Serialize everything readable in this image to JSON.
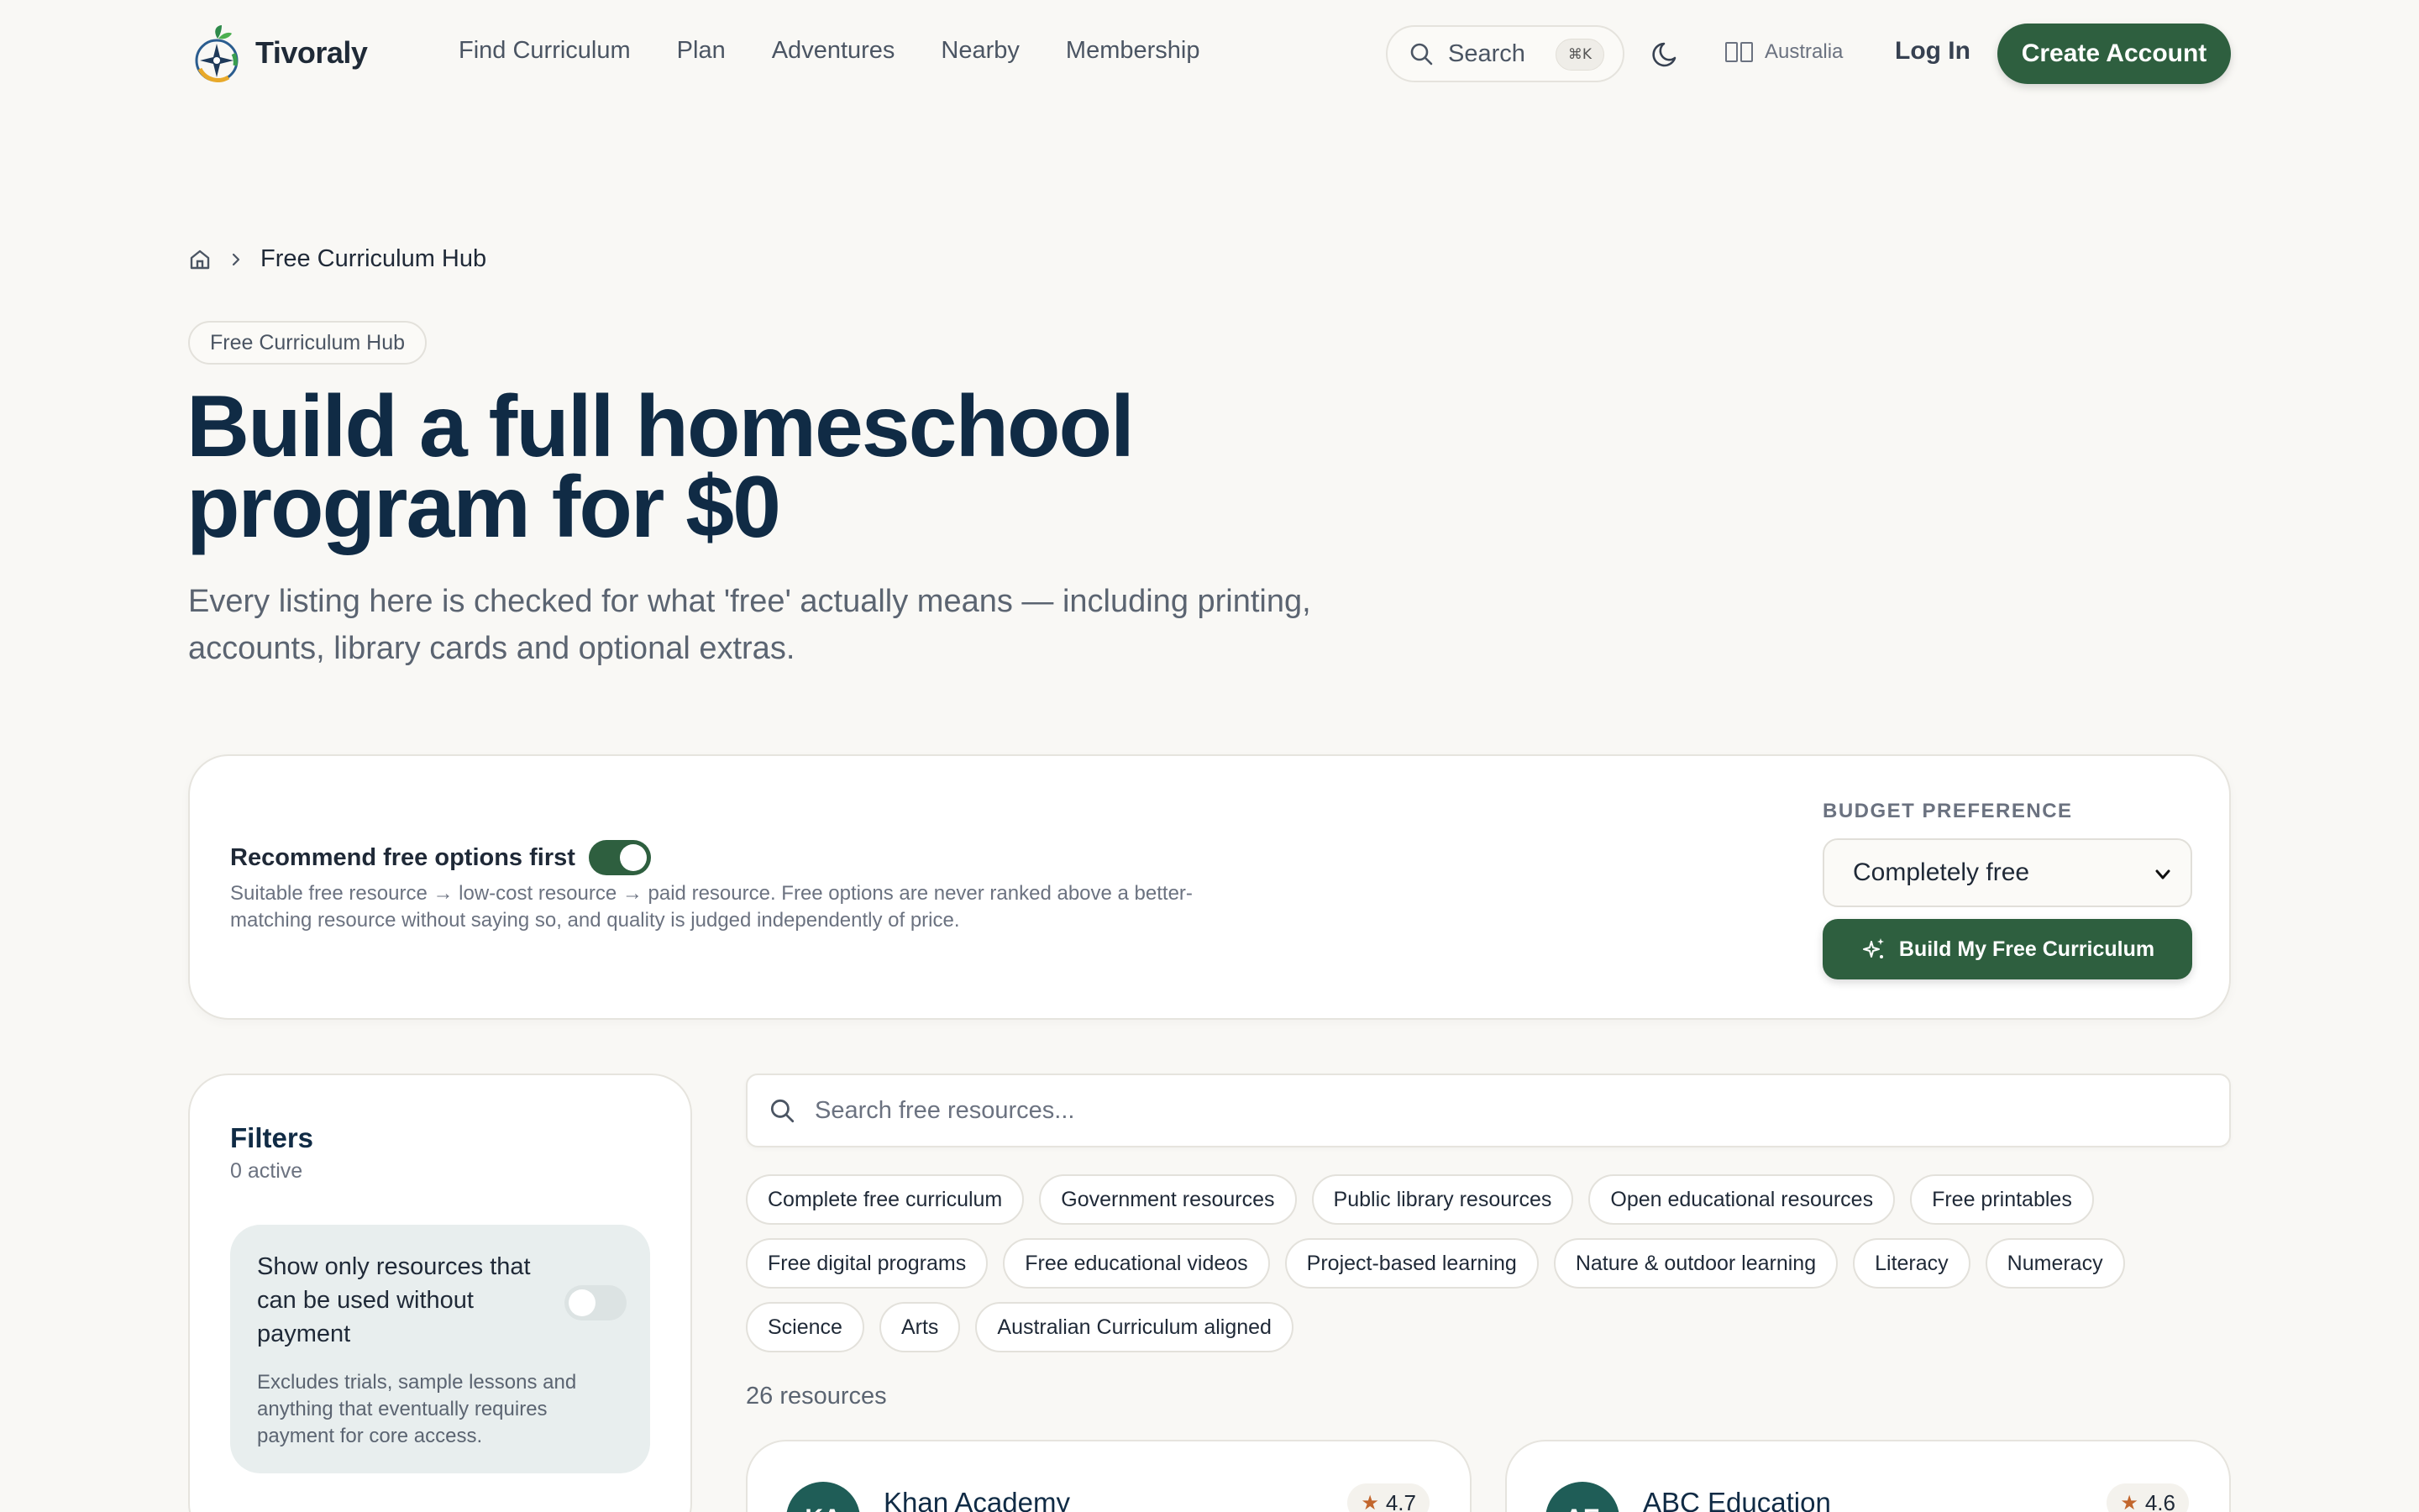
{
  "header": {
    "brand": "Tivoraly",
    "nav": [
      "Find Curriculum",
      "Plan",
      "Adventures",
      "Nearby",
      "Membership"
    ],
    "search_label": "Search",
    "search_shortcut": "⌘K",
    "region": "Australia",
    "login": "Log In",
    "create_account": "Create Account"
  },
  "breadcrumb": {
    "current": "Free Curriculum Hub"
  },
  "hero": {
    "tag": "Free Curriculum Hub",
    "title": "Build a full homeschool program for $0",
    "subtitle": "Every listing here is checked for what 'free' actually means — including printing, accounts, library cards and optional extras."
  },
  "preferences": {
    "recommend_label": "Recommend free options first",
    "recommend_on": true,
    "recommend_description": "Suitable free resource → low-cost resource → paid resource. Free options are never ranked above a better-matching resource without saying so, and quality is judged independently of price.",
    "budget_label": "BUDGET PREFERENCE",
    "budget_value": "Completely free",
    "build_button": "Build My Free Curriculum"
  },
  "filters": {
    "title": "Filters",
    "active": "0 active",
    "free_only_label": "Show only resources that can be used without payment",
    "free_only_on": false,
    "free_only_description": "Excludes trials, sample lessons and anything that eventually requires payment for core access."
  },
  "resources": {
    "search_placeholder": "Search free resources...",
    "chips": [
      "Complete free curriculum",
      "Government resources",
      "Public library resources",
      "Open educational resources",
      "Free printables",
      "Free digital programs",
      "Free educational videos",
      "Project-based learning",
      "Nature & outdoor learning",
      "Literacy",
      "Numeracy",
      "Science",
      "Arts",
      "Australian Curriculum aligned"
    ],
    "count": "26 resources",
    "cards": [
      {
        "initials": "KA",
        "name": "Khan Academy",
        "rating": "4.7"
      },
      {
        "initials": "AE",
        "name": "ABC Education",
        "rating": "4.6"
      }
    ]
  },
  "colors": {
    "primary_green": "#2e5f3f",
    "heading_navy": "#102b45",
    "background": "#f9f8f5",
    "star_orange": "#c2662d"
  }
}
